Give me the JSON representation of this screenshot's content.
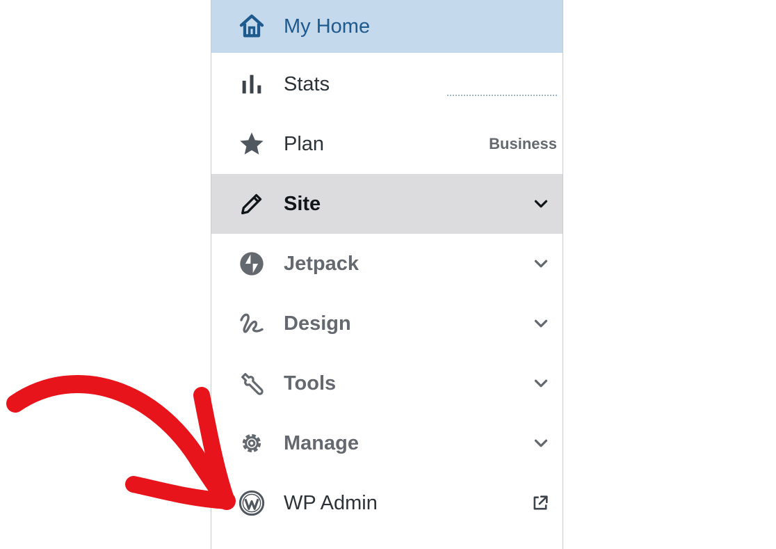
{
  "colors": {
    "active_bg": "#c5d9ed",
    "active_text": "#1e5a8e",
    "selected_bg": "#dcdcde",
    "muted_text": "#646970",
    "arrow": "#e8141b"
  },
  "sidebar": {
    "items": [
      {
        "label": "My Home",
        "icon": "house-icon"
      },
      {
        "label": "Stats",
        "icon": "bar-chart-icon"
      },
      {
        "label": "Plan",
        "icon": "star-icon",
        "badge": "Business"
      },
      {
        "label": "Site",
        "icon": "pencil-icon",
        "expander": "chevron-down-icon"
      },
      {
        "label": "Jetpack",
        "icon": "jetpack-icon",
        "expander": "chevron-down-icon"
      },
      {
        "label": "Design",
        "icon": "design-squiggle-icon",
        "expander": "chevron-down-icon"
      },
      {
        "label": "Tools",
        "icon": "wrench-icon",
        "expander": "chevron-down-icon"
      },
      {
        "label": "Manage",
        "icon": "gear-icon",
        "expander": "chevron-down-icon"
      },
      {
        "label": "WP Admin",
        "icon": "wordpress-icon",
        "trailing_icon": "external-link-icon"
      }
    ]
  },
  "annotation": {
    "icon": "red-arrow-icon"
  }
}
